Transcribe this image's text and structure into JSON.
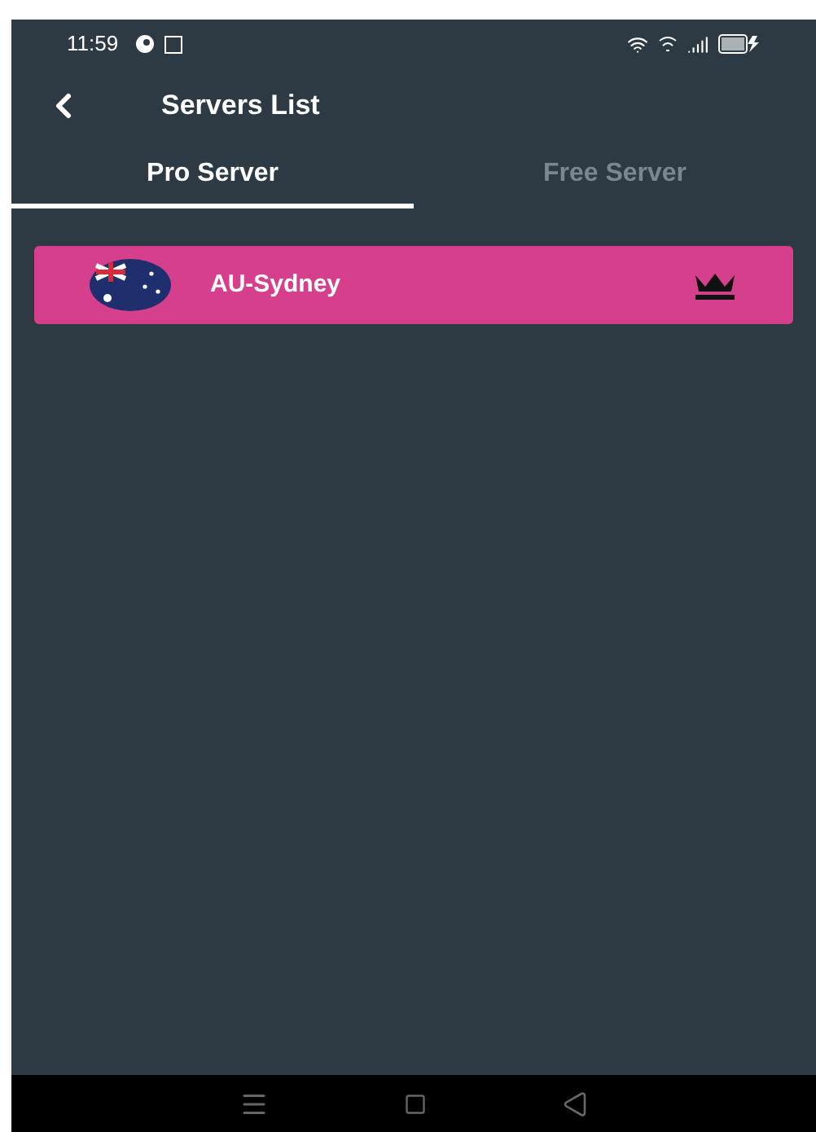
{
  "status_bar": {
    "time": "11:59"
  },
  "header": {
    "title": "Servers List"
  },
  "tabs": [
    {
      "label": "Pro Server",
      "selected": true
    },
    {
      "label": "Free Server",
      "selected": false
    }
  ],
  "servers": [
    {
      "name": "AU-Sydney",
      "premium": true
    }
  ]
}
